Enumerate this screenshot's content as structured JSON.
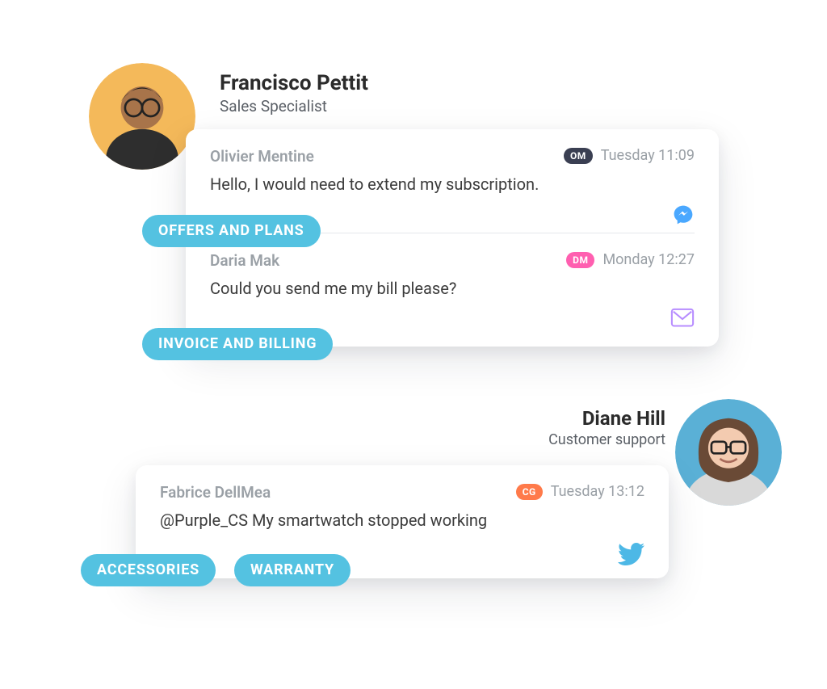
{
  "agents": {
    "top": {
      "name": "Francisco Pettit",
      "role": "Sales Specialist"
    },
    "bottom": {
      "name": "Diane Hill",
      "role": "Customer support"
    }
  },
  "cards": {
    "top": {
      "tickets": [
        {
          "sender": "Olivier Mentine",
          "badge_text": "OM",
          "badge_color": "#3a3f52",
          "time": "Tuesday 11:09",
          "msg": "Hello, I would need to extend my subscription.",
          "channel": "messenger",
          "channel_color": "#4aa8ff"
        },
        {
          "sender": "Daria Mak",
          "badge_text": "DM",
          "badge_color": "#ff5fb0",
          "time": "Monday 12:27",
          "msg": "Could you send me my bill please?",
          "channel": "mail",
          "channel_color": "#b78dff"
        }
      ]
    },
    "bottom": {
      "tickets": [
        {
          "sender": "Fabrice DellMea",
          "badge_text": "CG",
          "badge_color": "#ff7a4a",
          "time": "Tuesday 13:12",
          "msg": "@Purple_CS My smartwatch stopped working",
          "channel": "twitter",
          "channel_color": "#4db8e6"
        }
      ]
    }
  },
  "tags": {
    "top1": "OFFERS AND PLANS",
    "top2": "INVOICE AND BILLING",
    "bot1": "ACCESSORIES",
    "bot2": "WARRANTY"
  },
  "colors": {
    "tag_bg": "#54c2e1",
    "avatar_top_bg": "#f4b95a",
    "avatar_bottom_bg": "#5ab0d6"
  }
}
